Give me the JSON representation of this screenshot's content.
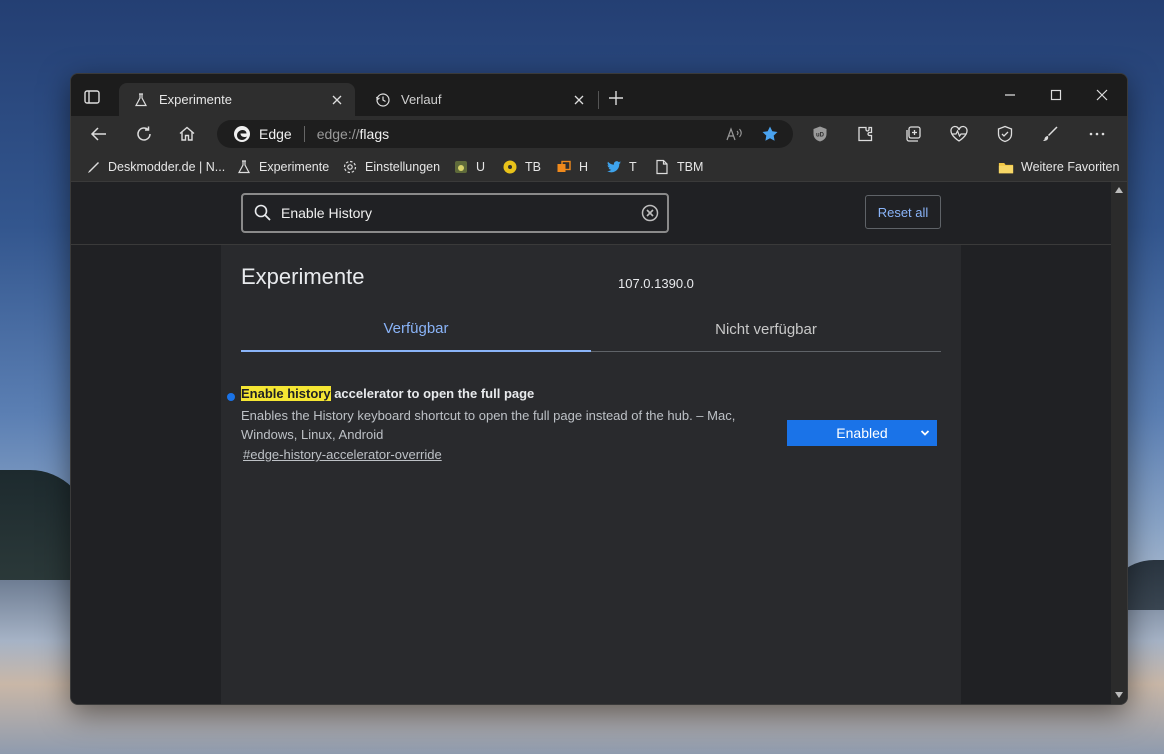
{
  "tabs": [
    {
      "label": "Experimente",
      "icon": "flask-icon",
      "active": true
    },
    {
      "label": "Verlauf",
      "icon": "history-icon",
      "active": false
    }
  ],
  "omnibox": {
    "brand": "Edge",
    "url_prefix": "edge://",
    "url_path": "flags"
  },
  "favorites": [
    {
      "label": "Deskmodder.de | N...",
      "icon": "pen-icon"
    },
    {
      "label": "Experimente",
      "icon": "flask-icon"
    },
    {
      "label": "Einstellungen",
      "icon": "gear-icon"
    },
    {
      "label": "U",
      "icon": "app-icon"
    },
    {
      "label": "TB",
      "icon": "disc-icon"
    },
    {
      "label": "H",
      "icon": "stack-icon"
    },
    {
      "label": "T",
      "icon": "twitter-icon"
    },
    {
      "label": "TBM",
      "icon": "page-icon"
    }
  ],
  "favorites_folder": {
    "label": "Weitere Favoriten",
    "icon": "folder-icon"
  },
  "search": {
    "value": "Enable History"
  },
  "reset_label": "Reset all",
  "page": {
    "title": "Experimente",
    "version": "107.0.1390.0",
    "tab_available": "Verfügbar",
    "tab_unavailable": "Nicht verfügbar"
  },
  "experiment": {
    "title_highlight": "Enable history",
    "title_rest": " accelerator to open the full page",
    "description": "Enables the History keyboard shortcut to open the full page instead of the hub. – Mac, Windows, Linux, Android",
    "link": "#edge-history-accelerator-override",
    "select_value": "Enabled"
  },
  "colors": {
    "accent": "#8ab4f8",
    "select_bg": "#1a73e8",
    "highlight": "#f5e633"
  }
}
